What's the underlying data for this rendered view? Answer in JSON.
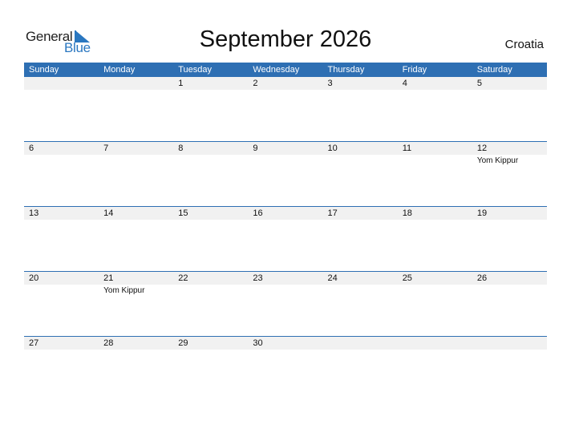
{
  "logo": {
    "general": "General",
    "blue": "Blue",
    "icon": "triangle-flag-icon"
  },
  "title": "September 2026",
  "country": "Croatia",
  "colors": {
    "header": "#2e6fb3",
    "strip": "#f1f1f1",
    "brand_blue": "#2a77c0"
  },
  "weekdays": [
    "Sunday",
    "Monday",
    "Tuesday",
    "Wednesday",
    "Thursday",
    "Friday",
    "Saturday"
  ],
  "weeks": [
    [
      {
        "day": ""
      },
      {
        "day": ""
      },
      {
        "day": "1"
      },
      {
        "day": "2"
      },
      {
        "day": "3"
      },
      {
        "day": "4"
      },
      {
        "day": "5"
      }
    ],
    [
      {
        "day": "6"
      },
      {
        "day": "7"
      },
      {
        "day": "8"
      },
      {
        "day": "9"
      },
      {
        "day": "10"
      },
      {
        "day": "11"
      },
      {
        "day": "12",
        "event": "Yom Kippur"
      }
    ],
    [
      {
        "day": "13"
      },
      {
        "day": "14"
      },
      {
        "day": "15"
      },
      {
        "day": "16"
      },
      {
        "day": "17"
      },
      {
        "day": "18"
      },
      {
        "day": "19"
      }
    ],
    [
      {
        "day": "20"
      },
      {
        "day": "21",
        "event": "Yom Kippur"
      },
      {
        "day": "22"
      },
      {
        "day": "23"
      },
      {
        "day": "24"
      },
      {
        "day": "25"
      },
      {
        "day": "26"
      }
    ],
    [
      {
        "day": "27"
      },
      {
        "day": "28"
      },
      {
        "day": "29"
      },
      {
        "day": "30"
      },
      {
        "day": ""
      },
      {
        "day": ""
      },
      {
        "day": ""
      }
    ]
  ]
}
